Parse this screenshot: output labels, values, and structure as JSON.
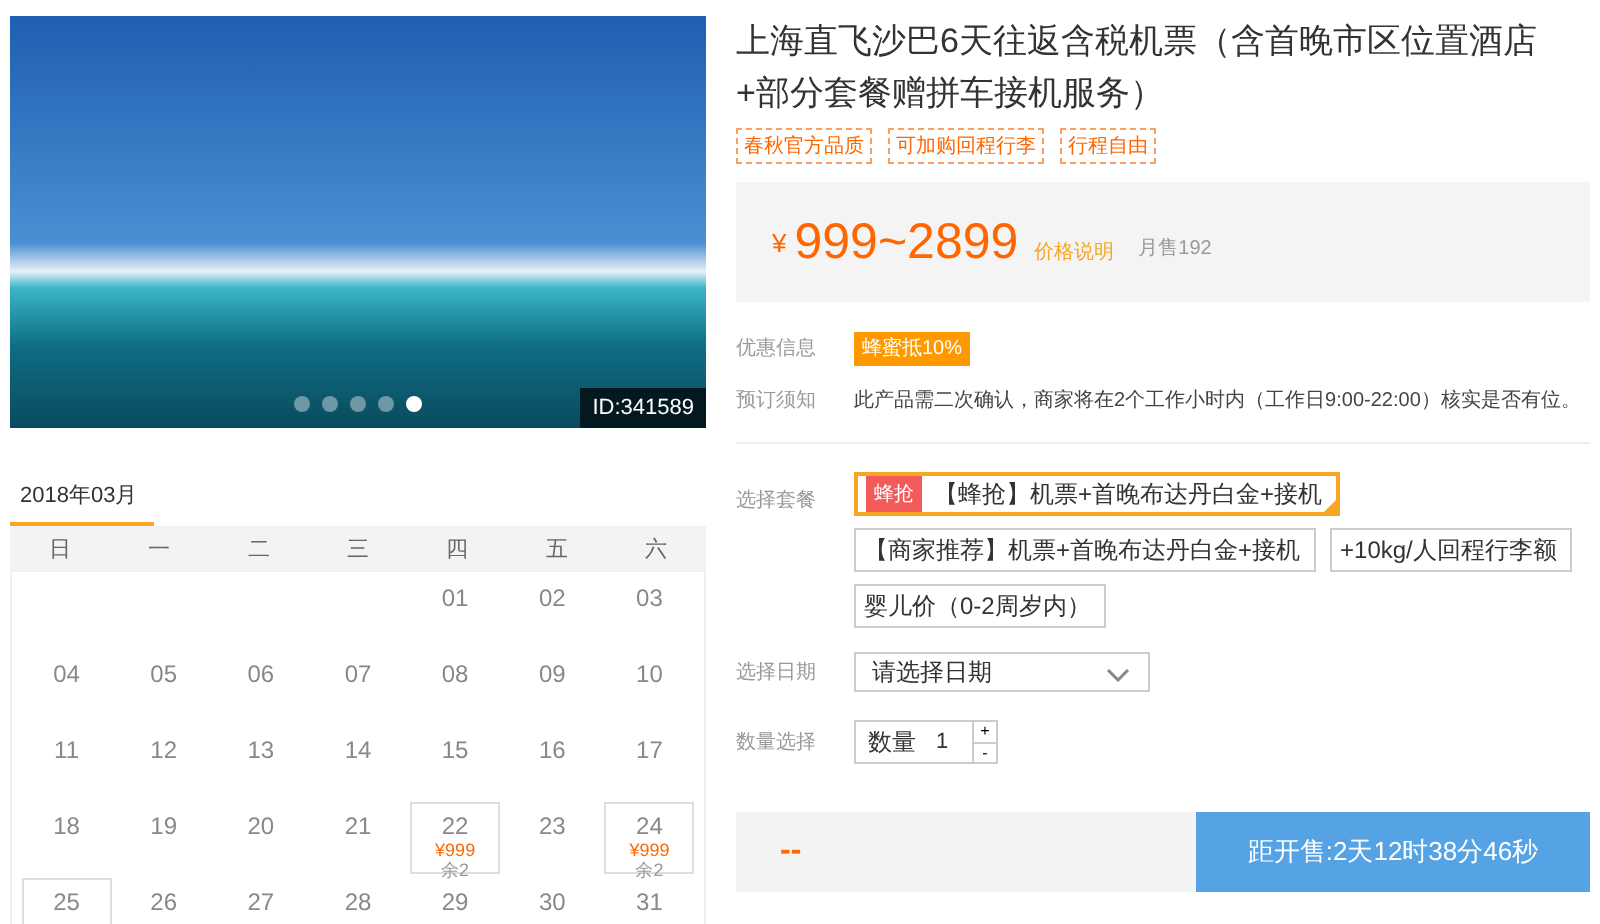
{
  "gallery": {
    "id_label": "ID:341589",
    "dots": [
      {
        "selected": false
      },
      {
        "selected": false
      },
      {
        "selected": false
      },
      {
        "selected": false
      },
      {
        "selected": true
      }
    ]
  },
  "calendar": {
    "month": "2018年03月",
    "weekdays": [
      "日",
      "一",
      "二",
      "三",
      "四",
      "五",
      "六"
    ],
    "days": [
      {
        "day": "01",
        "available": false
      },
      {
        "day": "02",
        "available": false
      },
      {
        "day": "03",
        "available": false
      },
      {
        "day": "04",
        "available": false
      },
      {
        "day": "05",
        "available": false
      },
      {
        "day": "06",
        "available": false
      },
      {
        "day": "07",
        "available": false
      },
      {
        "day": "08",
        "available": false
      },
      {
        "day": "09",
        "available": false
      },
      {
        "day": "10",
        "available": false
      },
      {
        "day": "11",
        "available": false
      },
      {
        "day": "12",
        "available": false
      },
      {
        "day": "13",
        "available": false
      },
      {
        "day": "14",
        "available": false
      },
      {
        "day": "15",
        "available": false
      },
      {
        "day": "16",
        "available": false
      },
      {
        "day": "17",
        "available": false
      },
      {
        "day": "18",
        "available": false
      },
      {
        "day": "19",
        "available": false
      },
      {
        "day": "20",
        "available": false
      },
      {
        "day": "21",
        "available": false
      },
      {
        "day": "22",
        "available": true,
        "price": "¥999",
        "stock": "余2"
      },
      {
        "day": "23",
        "available": false
      },
      {
        "day": "24",
        "available": true,
        "price": "¥999",
        "stock": "余2"
      },
      {
        "day": "25",
        "available": true
      },
      {
        "day": "26",
        "available": false
      },
      {
        "day": "27",
        "available": false
      },
      {
        "day": "28",
        "available": false
      },
      {
        "day": "29",
        "available": false
      },
      {
        "day": "30",
        "available": false
      },
      {
        "day": "31",
        "available": false
      }
    ]
  },
  "product": {
    "title": "上海直飞沙巴6天往返含税机票（含首晚市区位置酒店+部分套餐赠拼车接机服务）",
    "tags": [
      "春秋官方品质",
      "可加购回程行李",
      "行程自由"
    ],
    "price": {
      "currency": "¥",
      "range": "999~2899",
      "note": "价格说明",
      "sales": "月售192"
    },
    "promo": {
      "label": "优惠信息",
      "badge": "蜂蜜抵10%"
    },
    "notice": {
      "label": "预订须知",
      "text": "此产品需二次确认，商家将在2个工作小时内（工作日9:00-22:00）核实是否有位。"
    },
    "packages": {
      "label": "选择套餐",
      "options": [
        {
          "badge": "蜂抢",
          "text": "【蜂抢】机票+首晚布达丹白金+接机",
          "selected": true
        },
        {
          "text": "【商家推荐】机票+首晚布达丹白金+接机",
          "selected": false
        },
        {
          "text": "+10kg/人回程行李额",
          "selected": false
        },
        {
          "text": "婴儿价（0-2周岁内）",
          "selected": false
        }
      ]
    },
    "date": {
      "label": "选择日期",
      "placeholder": "请选择日期"
    },
    "quantity": {
      "label": "数量选择",
      "prefix": "数量",
      "value": "1",
      "plus": "+",
      "minus": "-"
    },
    "footer": {
      "total": "--",
      "button": "距开售:2天12时38分46秒"
    }
  }
}
